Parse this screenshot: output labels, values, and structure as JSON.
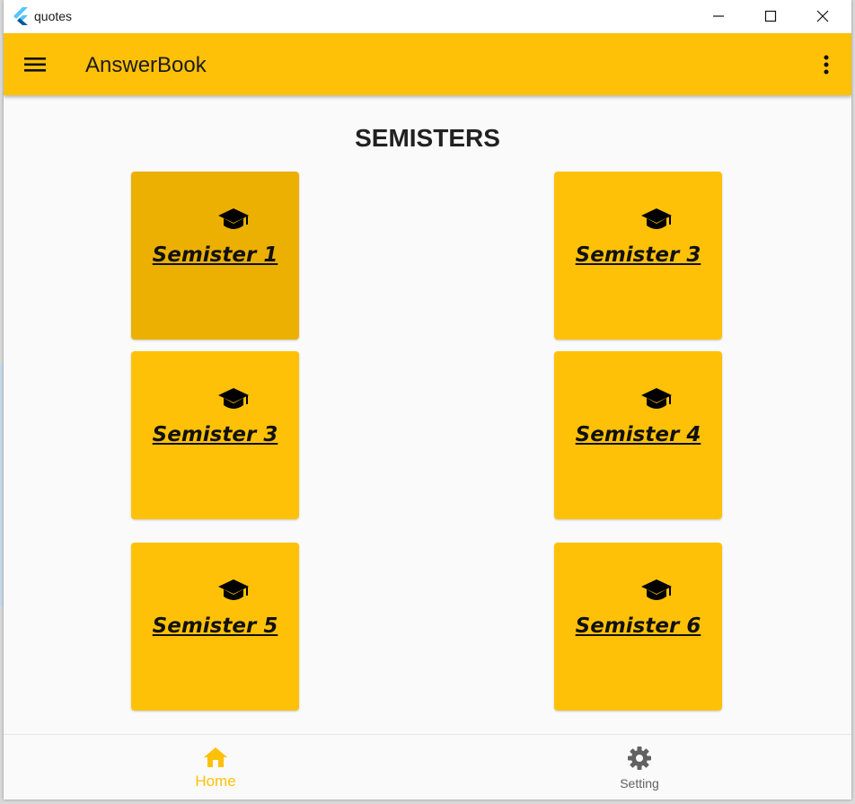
{
  "window": {
    "title": "quotes",
    "icons": {
      "app": "flutter-logo-icon",
      "minimize": "minimize-icon",
      "maximize": "maximize-icon",
      "close": "close-icon"
    }
  },
  "appbar": {
    "title": "AnswerBook",
    "background": "#ffc107",
    "menu_icon": "hamburger-menu-icon",
    "more_icon": "more-vert-icon"
  },
  "page": {
    "heading": "SEMISTERS"
  },
  "cards": [
    {
      "label": "Semister 1",
      "icon": "graduation-cap-icon",
      "selected": true
    },
    {
      "label": "Semister 3",
      "icon": "graduation-cap-icon"
    },
    {
      "label": "Semister 3",
      "icon": "graduation-cap-icon"
    },
    {
      "label": "Semister 4",
      "icon": "graduation-cap-icon"
    },
    {
      "label": "Semister 5",
      "icon": "graduation-cap-icon"
    },
    {
      "label": "Semister 6",
      "icon": "graduation-cap-icon"
    }
  ],
  "colors": {
    "card": "#ffc107",
    "card_selected": "#ebb002",
    "nav_active": "#ffc107",
    "nav_inactive": "#616161"
  },
  "bottom_nav": [
    {
      "label": "Home",
      "icon": "home-icon",
      "active": true
    },
    {
      "label": "Setting",
      "icon": "settings-icon",
      "active": false
    }
  ]
}
